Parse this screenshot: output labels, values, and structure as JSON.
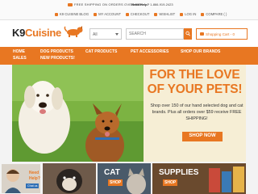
{
  "topbar": {
    "promo": "FREE SHIPPING ON ORDERS OVER $59!",
    "help_label": "Need Help?",
    "help_phone": "1-866-919-2423",
    "links": [
      "K9 CUISINE BLOG",
      "MY ACCOUNT",
      "CHECKOUT",
      "WISHLIST",
      "LOG IN",
      "COMPARE ( )"
    ]
  },
  "header": {
    "logo_k9": "K9",
    "logo_cuisine": "Cuisine",
    "select_value": "All",
    "search_placeholder": "SEARCH",
    "cart_label": "Shopping Cart - 0"
  },
  "nav": {
    "items": [
      "HOME",
      "DOG PRODUCTS",
      "CAT PRODUCTS",
      "PET ACCESSORIES",
      "SHOP OUR BRANDS",
      "SALES",
      "NEW PRODUCTS!"
    ]
  },
  "hero": {
    "title_line1": "FOR THE LOVE",
    "title_line2": "OF YOUR PETS!",
    "body": "Shop over 150 of our hand selected dog and cat brands. Plus all orders over $59 receive FREE SHIPPING!",
    "button": "SHOP NOW"
  },
  "tiles": {
    "needhelp_line1": "Need",
    "needhelp_line2": "Help?",
    "needhelp_btn": "Chat us",
    "cat_label": "CAT",
    "cat_sub": "SHOP",
    "supplies_label": "SUPPLIES",
    "supplies_sub": "SHOP"
  },
  "colors": {
    "accent": "#e87722",
    "nav_bg": "#e87722",
    "hero_panel": "#f6eed5"
  }
}
